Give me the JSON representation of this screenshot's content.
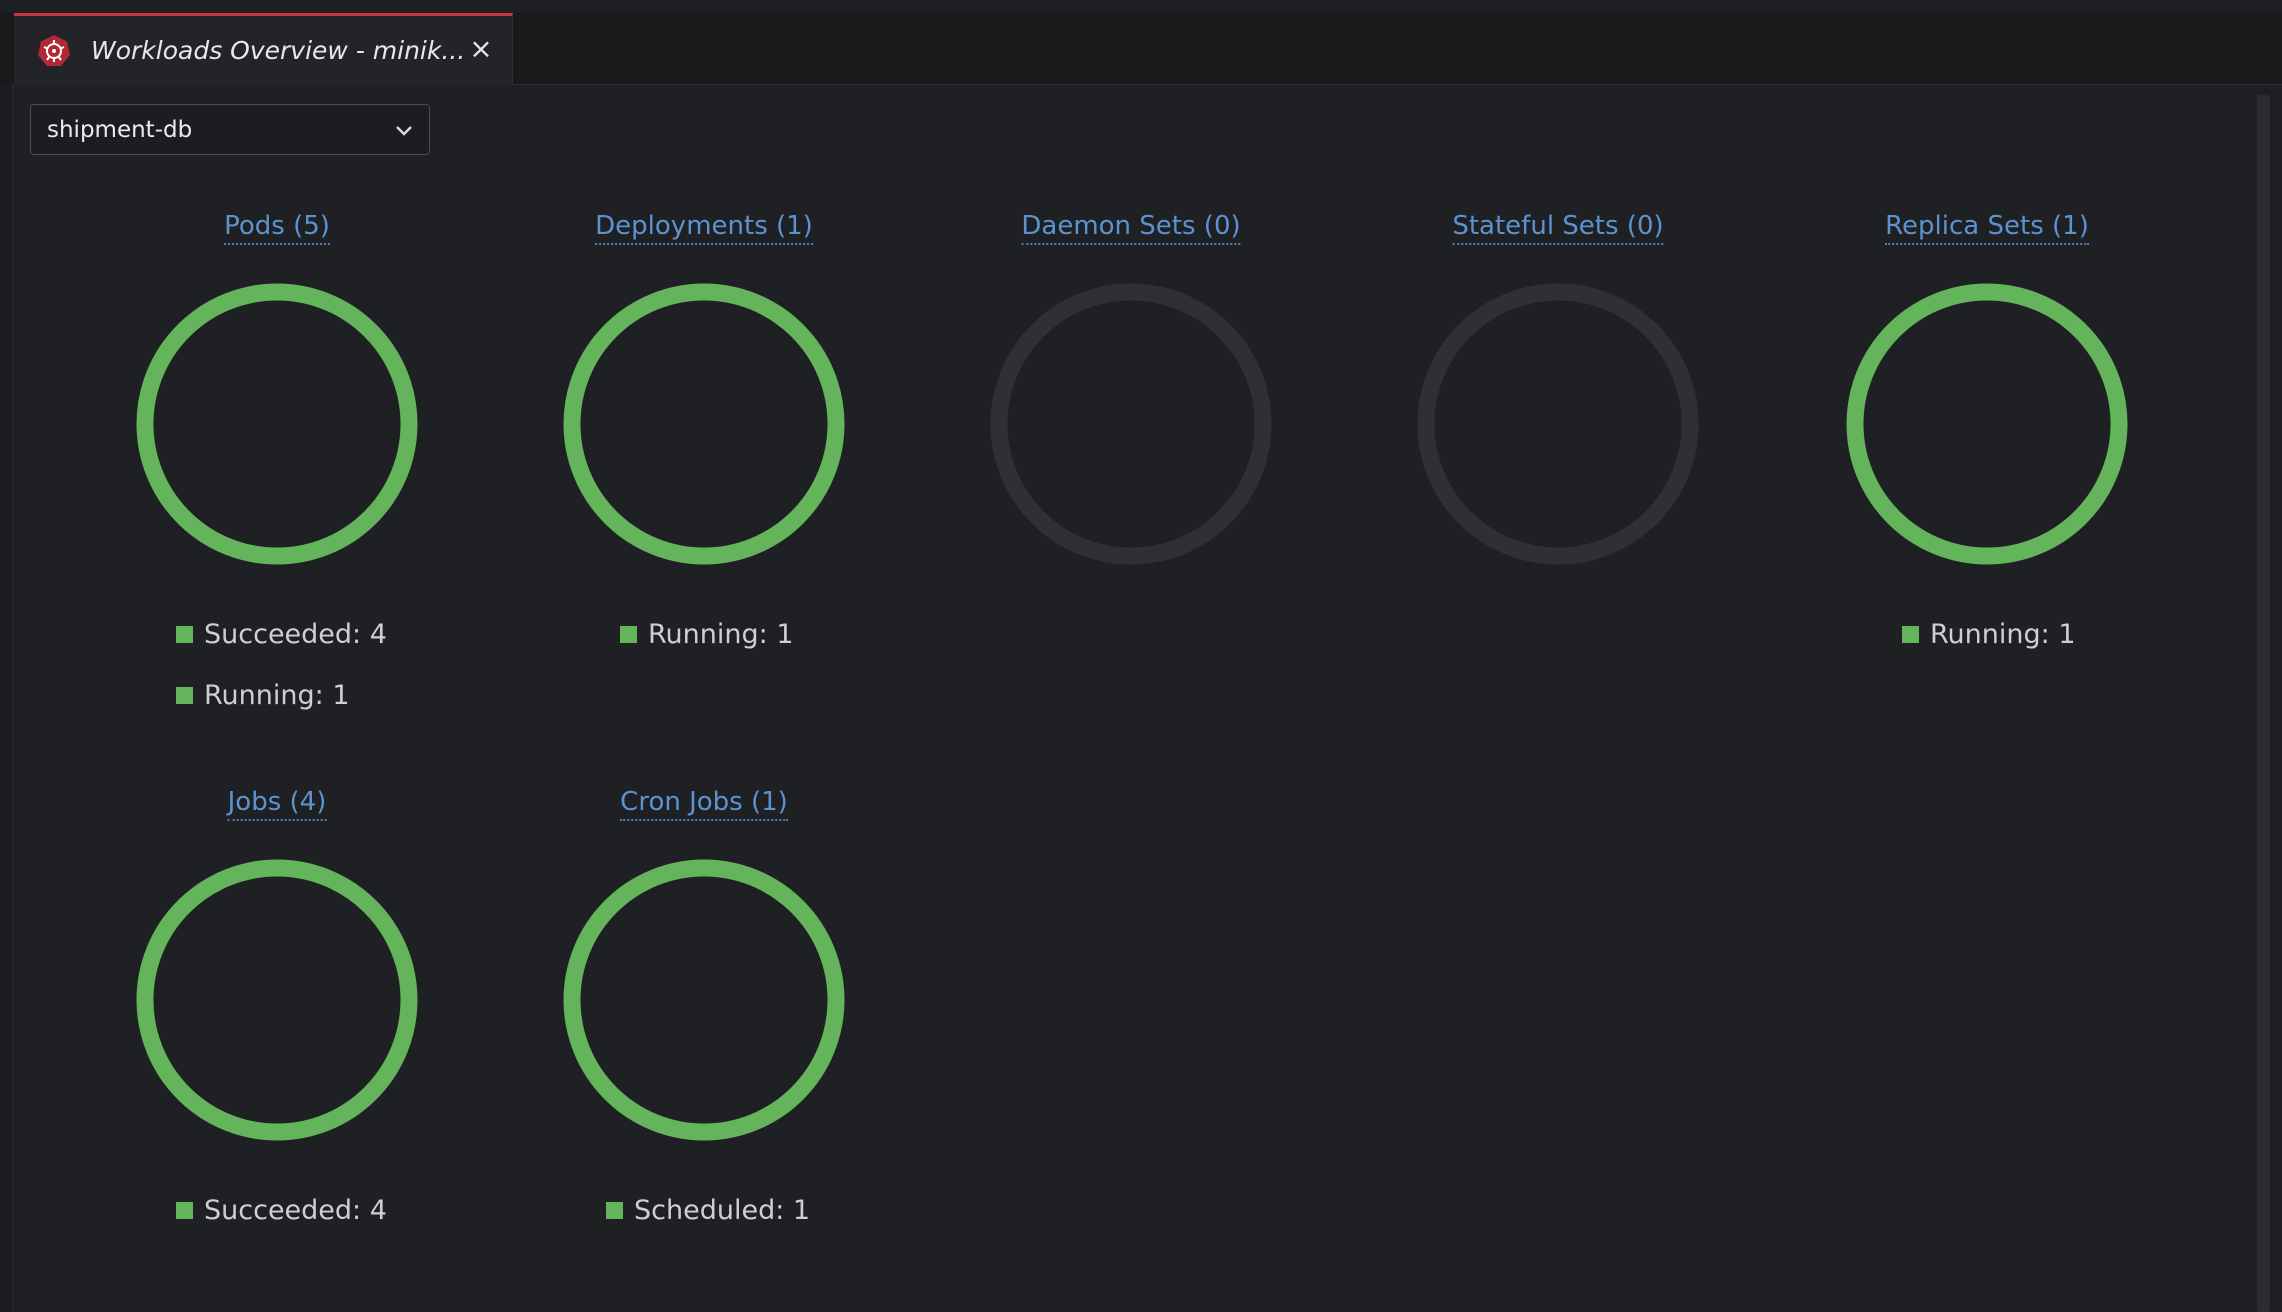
{
  "tab": {
    "title": "Workloads Overview - minik...",
    "close_symbol": "×",
    "icon": "kubernetes-icon"
  },
  "namespace_select": {
    "value": "shipment-db",
    "icon": "chevron-down-icon"
  },
  "colors": {
    "accent": "#c9343e",
    "link": "#5c93cf",
    "ring_active": "#63b45a",
    "ring_empty": "#2f3034",
    "background": "#1f2023"
  },
  "cards": [
    {
      "title": "Pods (5)",
      "ring": "active",
      "legend": [
        {
          "label": "Succeeded: 4"
        },
        {
          "label": "Running: 1"
        }
      ]
    },
    {
      "title": "Deployments (1)",
      "ring": "active",
      "legend": [
        {
          "label": "Running: 1"
        }
      ]
    },
    {
      "title": "Daemon Sets (0)",
      "ring": "empty",
      "legend": []
    },
    {
      "title": "Stateful Sets (0)",
      "ring": "empty",
      "legend": []
    },
    {
      "title": "Replica Sets (1)",
      "ring": "active",
      "legend": [
        {
          "label": "Running: 1"
        }
      ]
    },
    {
      "title": "Jobs (4)",
      "ring": "active",
      "legend": [
        {
          "label": "Succeeded: 4"
        }
      ]
    },
    {
      "title": "Cron Jobs (1)",
      "ring": "active",
      "legend": [
        {
          "label": "Scheduled: 1"
        }
      ]
    }
  ]
}
